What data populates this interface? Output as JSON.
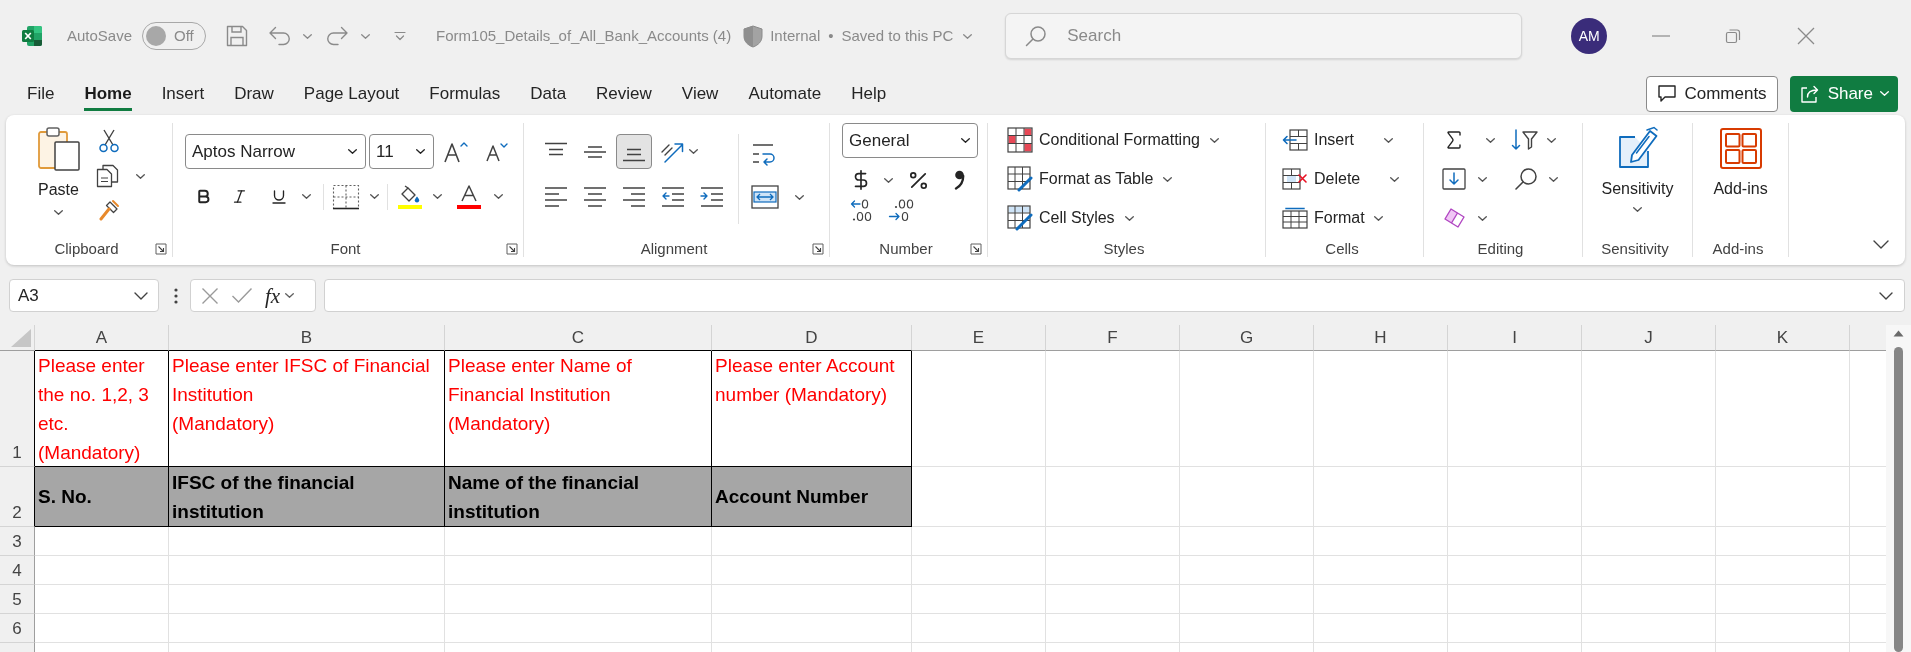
{
  "title_bar": {
    "autosave": {
      "label": "AutoSave",
      "on": false,
      "state": "Off"
    },
    "document_title": "Form105_Details_of_All_Bank_Accounts (4)",
    "sensitivity_label": "Internal",
    "separator": "•",
    "save_status": "Saved to this PC",
    "search": {
      "placeholder": "Search"
    },
    "account_initials": "AM"
  },
  "menu_tabs": [
    {
      "label": "File",
      "selected": false
    },
    {
      "label": "Home",
      "selected": true
    },
    {
      "label": "Insert",
      "selected": false
    },
    {
      "label": "Draw",
      "selected": false
    },
    {
      "label": "Page Layout",
      "selected": false
    },
    {
      "label": "Formulas",
      "selected": false
    },
    {
      "label": "Data",
      "selected": false
    },
    {
      "label": "Review",
      "selected": false
    },
    {
      "label": "View",
      "selected": false
    },
    {
      "label": "Automate",
      "selected": false
    },
    {
      "label": "Help",
      "selected": false
    }
  ],
  "comments_button": "Comments",
  "share_button": "Share",
  "ribbon": {
    "groups": [
      {
        "kind": "clipboard",
        "label": "Clipboard",
        "paste": "Paste"
      },
      {
        "kind": "font",
        "label": "Font",
        "font_name": "Aptos Narrow",
        "font_size": "11"
      },
      {
        "kind": "alignment",
        "label": "Alignment",
        "vertical_alignment": [
          {
            "kind": "top",
            "selected": false
          },
          {
            "kind": "middle",
            "selected": false
          },
          {
            "kind": "bottom",
            "selected": true
          }
        ]
      },
      {
        "kind": "number",
        "label": "Number",
        "number_format": "General"
      },
      {
        "kind": "styles",
        "label": "Styles",
        "commands": [
          "Conditional Formatting",
          "Format as Table",
          "Cell Styles"
        ]
      },
      {
        "kind": "cells",
        "label": "Cells",
        "commands": [
          "Insert",
          "Delete",
          "Format"
        ]
      },
      {
        "kind": "editing",
        "label": "Editing"
      },
      {
        "kind": "sensitivity",
        "label": "Sensitivity",
        "button": "Sensitivity"
      },
      {
        "kind": "add_ins",
        "label": "Add-ins",
        "button": "Add-ins"
      }
    ]
  },
  "formula_bar": {
    "name_box": "A3",
    "function_button": "fx"
  },
  "sheet": {
    "columns": [
      "A",
      "B",
      "C",
      "D",
      "E",
      "F",
      "G",
      "H",
      "I",
      "J",
      "K"
    ],
    "rows": [
      {
        "number": "1",
        "cells": [
          {
            "kind": "instruction",
            "text": "Please enter the no. 1,2, 3 etc. (Mandatory)"
          },
          {
            "kind": "instruction",
            "text": "Please enter IFSC of Financial Institution\n(Mandatory)"
          },
          {
            "kind": "instruction",
            "text": "Please enter Name of Financial Institution (Mandatory)"
          },
          {
            "kind": "instruction",
            "text": "Please enter Account number (Mandatory)"
          }
        ]
      },
      {
        "number": "2",
        "cells": [
          {
            "kind": "heading",
            "text": "S. No."
          },
          {
            "kind": "heading",
            "text": "IFSC of the financial institution"
          },
          {
            "kind": "heading",
            "text": "Name of the financial institution"
          },
          {
            "kind": "heading",
            "text": "Account Number"
          }
        ]
      },
      {
        "number": "3"
      },
      {
        "number": "4"
      },
      {
        "number": "5"
      },
      {
        "number": "6"
      }
    ]
  }
}
